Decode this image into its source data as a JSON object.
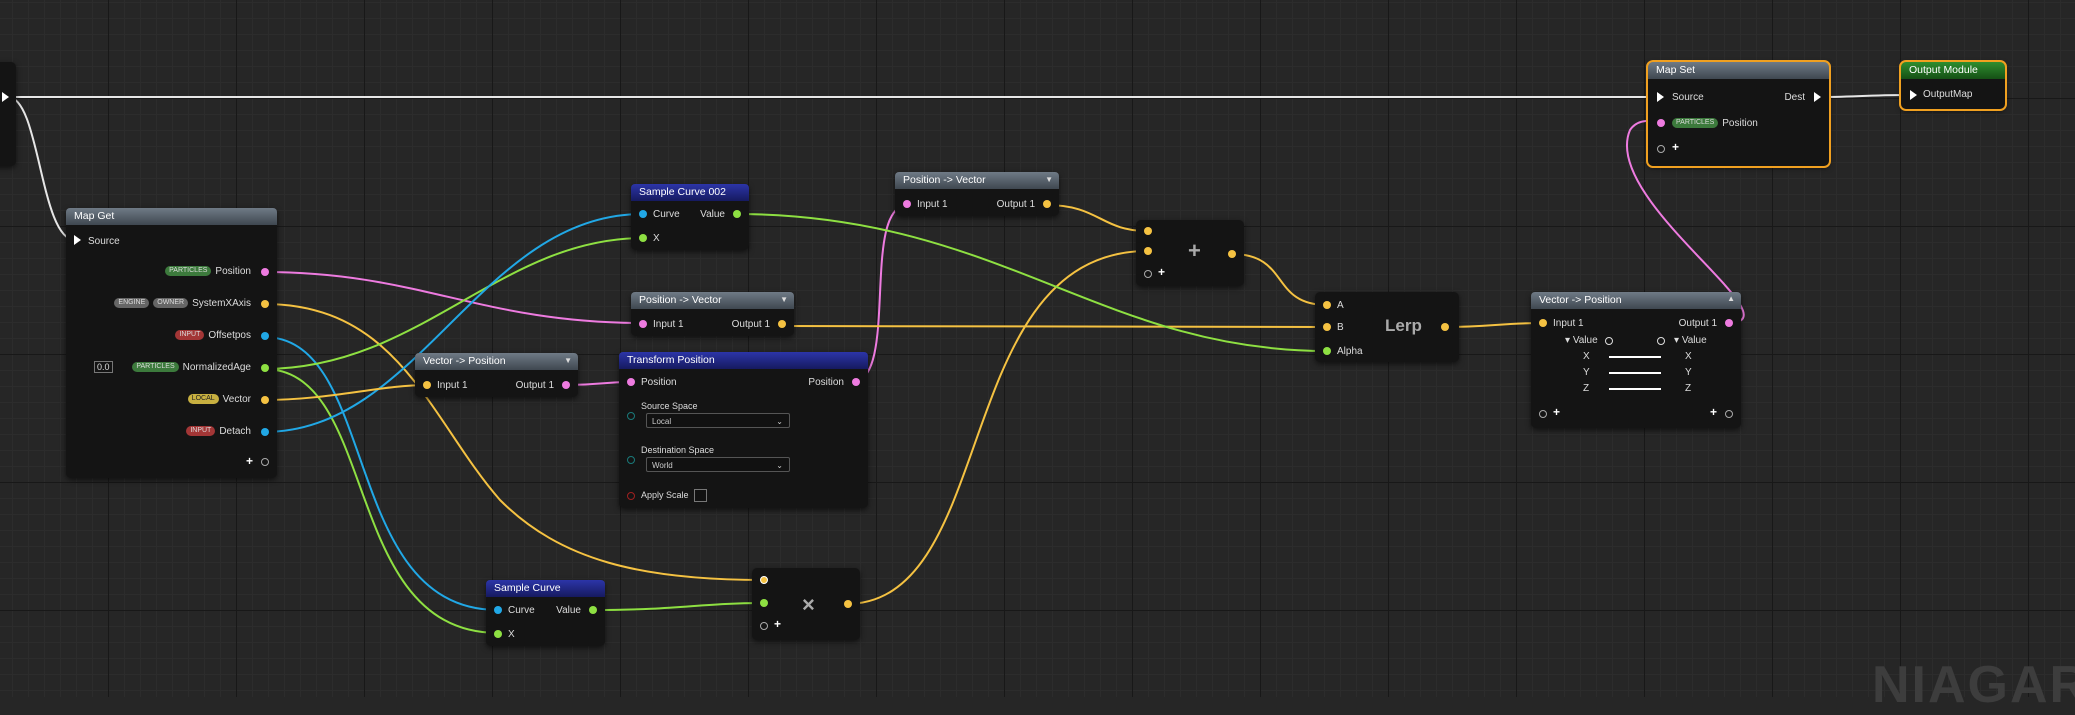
{
  "watermark": "NIAGAR",
  "colors": {
    "float": "#f5c242",
    "position": "#ee7be0",
    "curve": "#21a8e6",
    "vector2": "#8ee042",
    "exec": "#e6e6e6",
    "selection": "#f0a020"
  },
  "tags": {
    "particles": "PARTICLES",
    "engine": "ENGINE",
    "owner": "OWNER",
    "input": "INPUT",
    "local": "LOCAL"
  },
  "map_get": {
    "title": "Map Get",
    "source": "Source",
    "position": "Position",
    "system_xaxis": "SystemXAxis",
    "offsetpos": "Offsetpos",
    "normalized_age": "NormalizedAge",
    "vector": "Vector",
    "detach": "Detach",
    "default_value": "0.0"
  },
  "map_set": {
    "title": "Map Set",
    "source": "Source",
    "dest": "Dest",
    "position": "Position"
  },
  "output_module": {
    "title": "Output Module",
    "output_map": "OutputMap"
  },
  "sample_curve_002": {
    "title": "Sample Curve 002",
    "curve": "Curve",
    "value": "Value",
    "x": "X"
  },
  "sample_curve": {
    "title": "Sample Curve",
    "curve": "Curve",
    "value": "Value",
    "x": "X"
  },
  "pos_to_vec_1": {
    "title": "Position -> Vector",
    "input": "Input 1",
    "output": "Output 1"
  },
  "pos_to_vec_2": {
    "title": "Position -> Vector",
    "input": "Input 1",
    "output": "Output 1"
  },
  "vec_to_pos_1": {
    "title": "Vector -> Position",
    "input": "Input 1",
    "output": "Output 1"
  },
  "vec_to_pos_2": {
    "title": "Vector -> Position",
    "input": "Input 1",
    "output": "Output 1",
    "value": "Value",
    "x": "X",
    "y": "Y",
    "z": "Z"
  },
  "transform_position": {
    "title": "Transform Position",
    "position": "Position",
    "source_space_label": "Source Space",
    "source_space_value": "Local",
    "dest_space_label": "Destination Space",
    "dest_space_value": "World",
    "apply_scale": "Apply Scale"
  },
  "add_node": {
    "symbol": "+"
  },
  "multiply_node": {
    "symbol": "×"
  },
  "lerp_node": {
    "title": "Lerp",
    "a": "A",
    "b": "B",
    "alpha": "Alpha"
  }
}
